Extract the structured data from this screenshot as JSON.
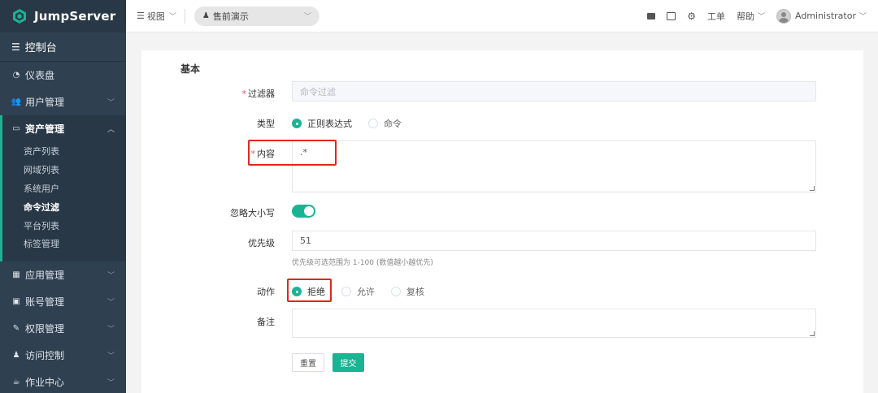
{
  "sidebar": {
    "brand": "JumpServer",
    "console": "控制台",
    "items": [
      {
        "label": "仪表盘",
        "icon": "dashboard-icon"
      },
      {
        "label": "用户管理",
        "icon": "users-icon",
        "chevron": "down"
      },
      {
        "label": "资产管理",
        "icon": "inbox-icon",
        "chevron": "up",
        "open": true
      },
      {
        "label": "应用管理",
        "icon": "grid-icon",
        "chevron": "down"
      },
      {
        "label": "账号管理",
        "icon": "address-book-icon",
        "chevron": "down"
      },
      {
        "label": "权限管理",
        "icon": "edit-icon",
        "chevron": "down"
      },
      {
        "label": "访问控制",
        "icon": "sitemap-icon",
        "chevron": "down"
      },
      {
        "label": "作业中心",
        "icon": "coffee-icon",
        "chevron": "down"
      }
    ],
    "asset_sub_items": [
      "资产列表",
      "网域列表",
      "系统用户",
      "命令过滤",
      "平台列表",
      "标签管理"
    ],
    "active_sub_item": "命令过滤"
  },
  "topbar": {
    "view_label": "视图",
    "org_label": "售前演示",
    "ticket_label": "工单",
    "help_label": "帮助",
    "user_name": "Administrator"
  },
  "form": {
    "section_title": "基本",
    "filter_label": "过滤器",
    "filter_value": "命令过滤",
    "type_label": "类型",
    "type_options": [
      "正则表达式",
      "命令"
    ],
    "type_selected": "正则表达式",
    "content_label": "内容",
    "content_value": ".*",
    "ignore_case_label": "忽略大小写",
    "ignore_case_on": true,
    "priority_label": "优先级",
    "priority_value": "51",
    "priority_hint": "优先级可选范围为 1-100 (数值越小越优先)",
    "action_label": "动作",
    "action_options": [
      "拒绝",
      "允许",
      "复核"
    ],
    "action_selected": "拒绝",
    "comment_label": "备注",
    "comment_value": "",
    "reset_label": "重置",
    "submit_label": "提交"
  },
  "colors": {
    "sidebar_bg": "#2f4050",
    "accent": "#1ab394",
    "highlight": "#e3261c"
  }
}
